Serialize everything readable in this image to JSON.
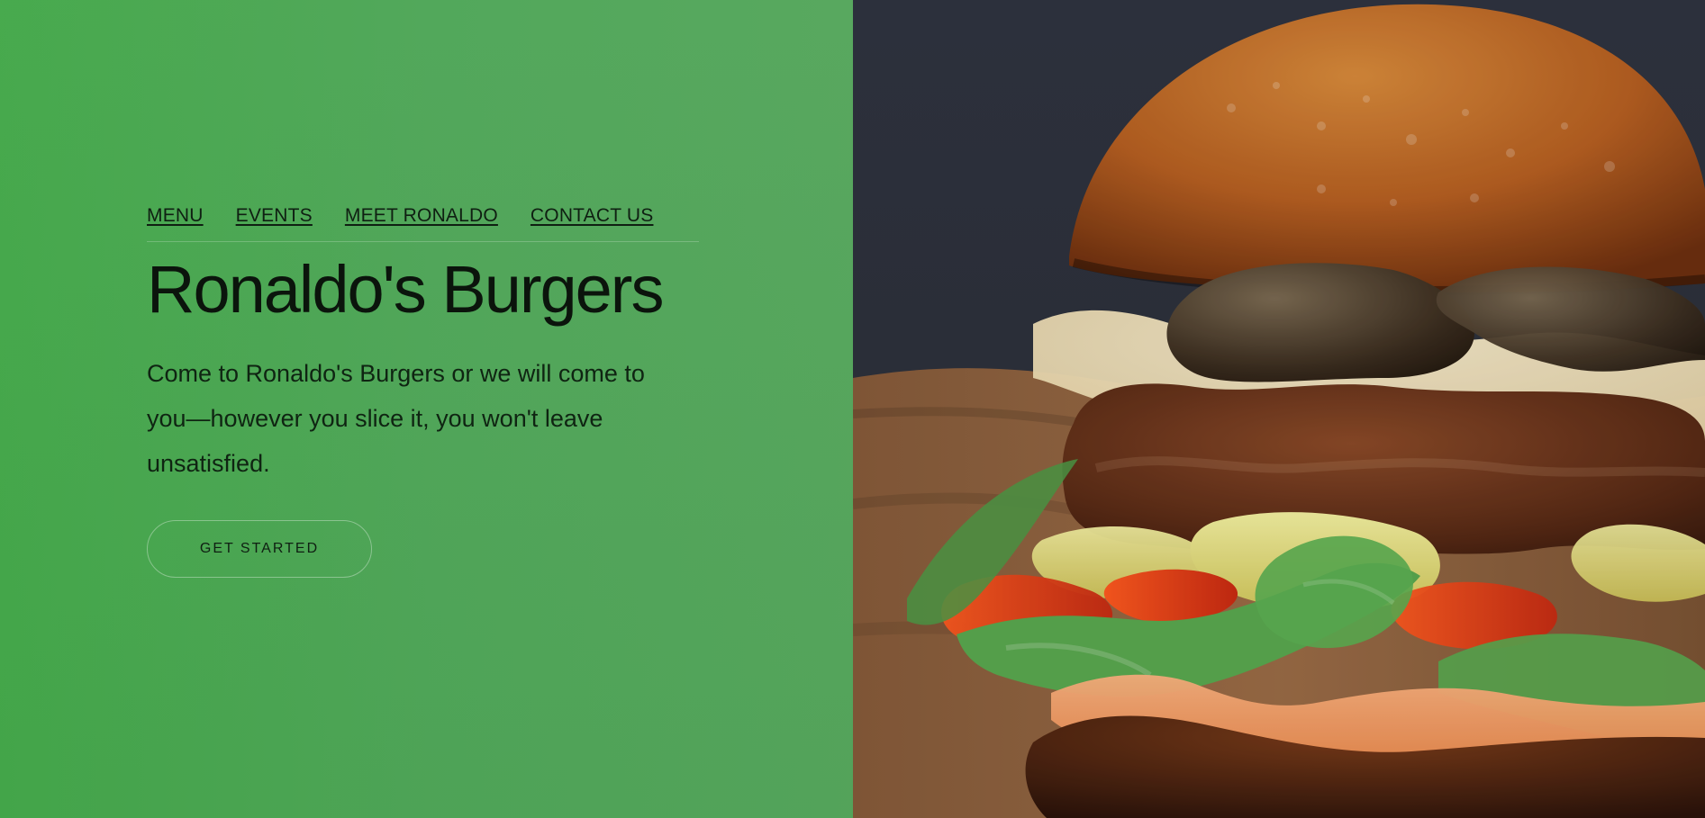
{
  "nav": {
    "items": [
      {
        "label": "MENU"
      },
      {
        "label": "EVENTS"
      },
      {
        "label": "MEET RONALDO"
      },
      {
        "label": "CONTACT US"
      }
    ]
  },
  "hero": {
    "title": "Ronaldo's Burgers",
    "description": "Come to Ronaldo's Burgers or we will come to you—however you slice it, you won't leave unsatisfied.",
    "cta_label": "GET STARTED"
  },
  "colors": {
    "accent_green": "#4ca651",
    "panel_dark": "#2c303a"
  },
  "image": {
    "subject": "burger-photo"
  }
}
